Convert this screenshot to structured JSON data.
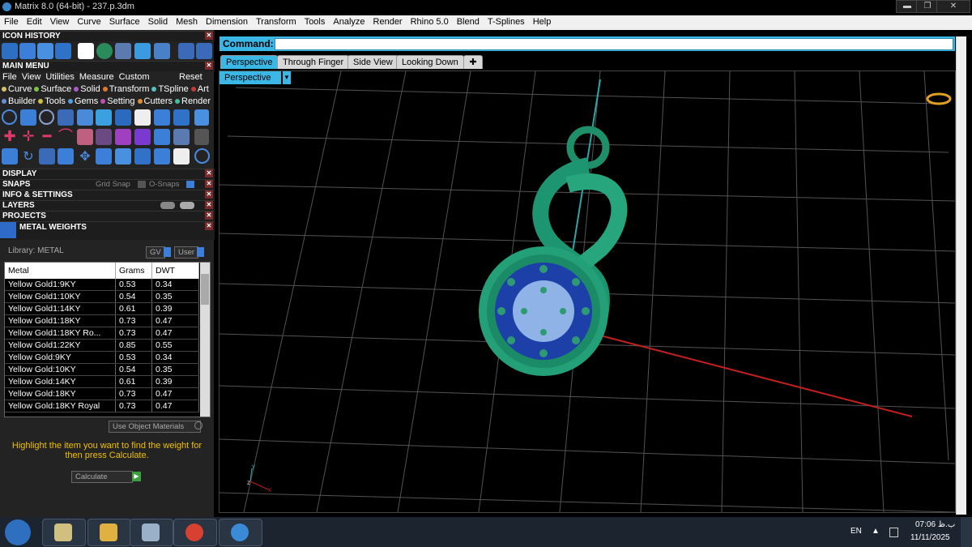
{
  "window": {
    "title": "Matrix 8.0 (64-bit) - 237.p.3dm",
    "controls": [
      "minimize",
      "restore",
      "close"
    ]
  },
  "menubar": {
    "items": [
      "File",
      "Edit",
      "View",
      "Curve",
      "Surface",
      "Solid",
      "Mesh",
      "Dimension",
      "Transform",
      "Tools",
      "Analyze",
      "Render",
      "Rhino 5.0",
      "Blend",
      "T-Splines",
      "Help"
    ]
  },
  "left_panel": {
    "icon_history": "ICON HISTORY",
    "main_menu": "MAIN MENU",
    "main_menu_row1": [
      "File",
      "View",
      "Utilities",
      "Measure",
      "Custom"
    ],
    "main_menu_reset": "Reset",
    "main_menu_row2": [
      {
        "label": "Curve",
        "color": "#d9c26a"
      },
      {
        "label": "Surface",
        "color": "#7fc24a"
      },
      {
        "label": "Solid",
        "color": "#b05ad0"
      },
      {
        "label": "Transform",
        "color": "#e07a2a"
      },
      {
        "label": "TSpline",
        "color": "#59c0c0"
      },
      {
        "label": "Art",
        "color": "#c23a3a"
      }
    ],
    "main_menu_row3": [
      {
        "label": "Builder",
        "color": "#6a8fd0"
      },
      {
        "label": "Tools",
        "color": "#d0c040"
      },
      {
        "label": "Gems",
        "color": "#50a0e0"
      },
      {
        "label": "Setting",
        "color": "#c050b0"
      },
      {
        "label": "Cutters",
        "color": "#e09030"
      },
      {
        "label": "Render",
        "color": "#40c0a0"
      }
    ],
    "display": "DISPLAY",
    "snaps": "SNAPS",
    "grid_snap": "Grid Snap",
    "o_snaps": "O-Snaps",
    "info_settings": "INFO & SETTINGS",
    "layers": "LAYERS",
    "projects": "PROJECTS",
    "metal_weights": "METAL WEIGHTS",
    "library": "Library: METAL",
    "gv_btn": "GV",
    "user_btn": "User",
    "table": {
      "headers": [
        "Metal",
        "Grams",
        "DWT"
      ],
      "rows": [
        [
          "Yellow Gold1:9KY",
          "0.53",
          "0.34"
        ],
        [
          "Yellow Gold1:10KY",
          "0.54",
          "0.35"
        ],
        [
          "Yellow Gold1:14KY",
          "0.61",
          "0.39"
        ],
        [
          "Yellow Gold1:18KY",
          "0.73",
          "0.47"
        ],
        [
          "Yellow Gold1:18KY Ro...",
          "0.73",
          "0.47"
        ],
        [
          "Yellow Gold1:22KY",
          "0.85",
          "0.55"
        ],
        [
          "Yellow Gold:9KY",
          "0.53",
          "0.34"
        ],
        [
          "Yellow Gold:10KY",
          "0.54",
          "0.35"
        ],
        [
          "Yellow Gold:14KY",
          "0.61",
          "0.39"
        ],
        [
          "Yellow Gold:18KY",
          "0.73",
          "0.47"
        ],
        [
          "Yellow Gold:18KY Royal",
          "0.73",
          "0.47"
        ]
      ]
    },
    "use_object_materials": "Use Object Materials",
    "hint": "Highlight the item you want to find the weight for then press Calculate.",
    "calculate": "Calculate"
  },
  "command": {
    "label": "Command:",
    "value": ""
  },
  "viewport_tabs": [
    "Perspective",
    "Through Finger",
    "Side View",
    "Looking Down"
  ],
  "viewport": {
    "name": "Perspective",
    "axes": [
      "y",
      "z",
      "x"
    ]
  },
  "taskbar": {
    "lang": "EN",
    "time": "07:06 ب.ظ",
    "date": "11/11/2025"
  }
}
